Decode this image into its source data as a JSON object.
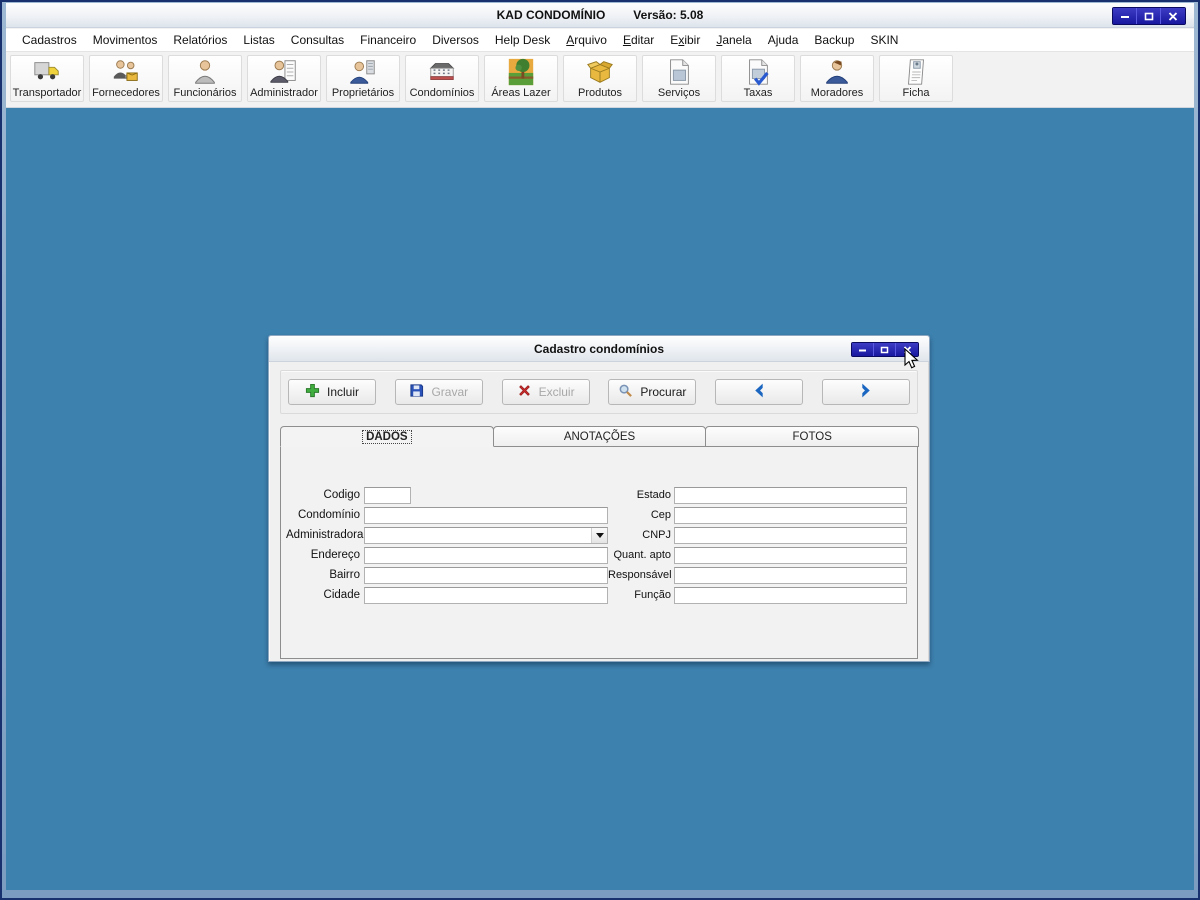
{
  "window": {
    "title": "KAD CONDOMÍNIO",
    "version": "Versão: 5.08"
  },
  "menu": {
    "items": [
      {
        "pre": "Cadastros",
        "key": "",
        "rest": ""
      },
      {
        "pre": "Movimentos",
        "key": "",
        "rest": ""
      },
      {
        "pre": "Relatórios",
        "key": "",
        "rest": ""
      },
      {
        "pre": "Listas",
        "key": "",
        "rest": ""
      },
      {
        "pre": "Consultas",
        "key": "",
        "rest": ""
      },
      {
        "pre": "Financeiro",
        "key": "",
        "rest": ""
      },
      {
        "pre": "Diversos",
        "key": "",
        "rest": ""
      },
      {
        "pre": "Help Desk",
        "key": "",
        "rest": ""
      },
      {
        "pre": "",
        "key": "A",
        "rest": "rquivo"
      },
      {
        "pre": "",
        "key": "E",
        "rest": "ditar"
      },
      {
        "pre": "E",
        "key": "x",
        "rest": "ibir"
      },
      {
        "pre": "",
        "key": "J",
        "rest": "anela"
      },
      {
        "pre": "Ajuda",
        "key": "",
        "rest": ""
      },
      {
        "pre": "Backup",
        "key": "",
        "rest": ""
      },
      {
        "pre": "SKIN",
        "key": "",
        "rest": ""
      }
    ]
  },
  "toolbar": {
    "buttons": [
      {
        "label": "Transportador",
        "icon": "truck-icon"
      },
      {
        "label": "Fornecedores",
        "icon": "suppliers-people-icon"
      },
      {
        "label": "Funcionários",
        "icon": "employee-person-icon"
      },
      {
        "label": "Administrador",
        "icon": "administrator-list-icon"
      },
      {
        "label": "Proprietários",
        "icon": "owner-building-icon"
      },
      {
        "label": "Condomínios",
        "icon": "condo-building-icon"
      },
      {
        "label": "Áreas Lazer",
        "icon": "leisure-park-icon"
      },
      {
        "label": "Produtos",
        "icon": "product-box-icon"
      },
      {
        "label": "Serviços",
        "icon": "services-document-icon"
      },
      {
        "label": "Taxas",
        "icon": "fees-check-document-icon"
      },
      {
        "label": "Moradores",
        "icon": "resident-person-icon"
      },
      {
        "label": "Ficha",
        "icon": "record-card-icon"
      }
    ]
  },
  "dialog": {
    "title": "Cadastro condomínios",
    "actions": {
      "incluir": "Incluir",
      "gravar": "Gravar",
      "excluir": "Excluir",
      "procurar": "Procurar"
    },
    "tabs": [
      "DADOS",
      "ANOTAÇÕES",
      "FOTOS"
    ],
    "form": {
      "left": [
        {
          "label": "Codigo",
          "value": ""
        },
        {
          "label": "Condomínio",
          "value": ""
        },
        {
          "label": "Administradora",
          "value": ""
        },
        {
          "label": "Endereço",
          "value": ""
        },
        {
          "label": "Bairro",
          "value": ""
        },
        {
          "label": "Cidade",
          "value": ""
        }
      ],
      "right": [
        {
          "label": "Estado",
          "value": ""
        },
        {
          "label": "Cep",
          "value": ""
        },
        {
          "label": "CNPJ",
          "value": ""
        },
        {
          "label": "Quant. apto",
          "value": ""
        },
        {
          "label": "Responsável",
          "value": ""
        },
        {
          "label": "Função",
          "value": ""
        }
      ]
    }
  },
  "colors": {
    "desktop": "#3d81ae",
    "titlebar_button_navy": "#1717a0",
    "accent_blue": "#1a66c0"
  }
}
